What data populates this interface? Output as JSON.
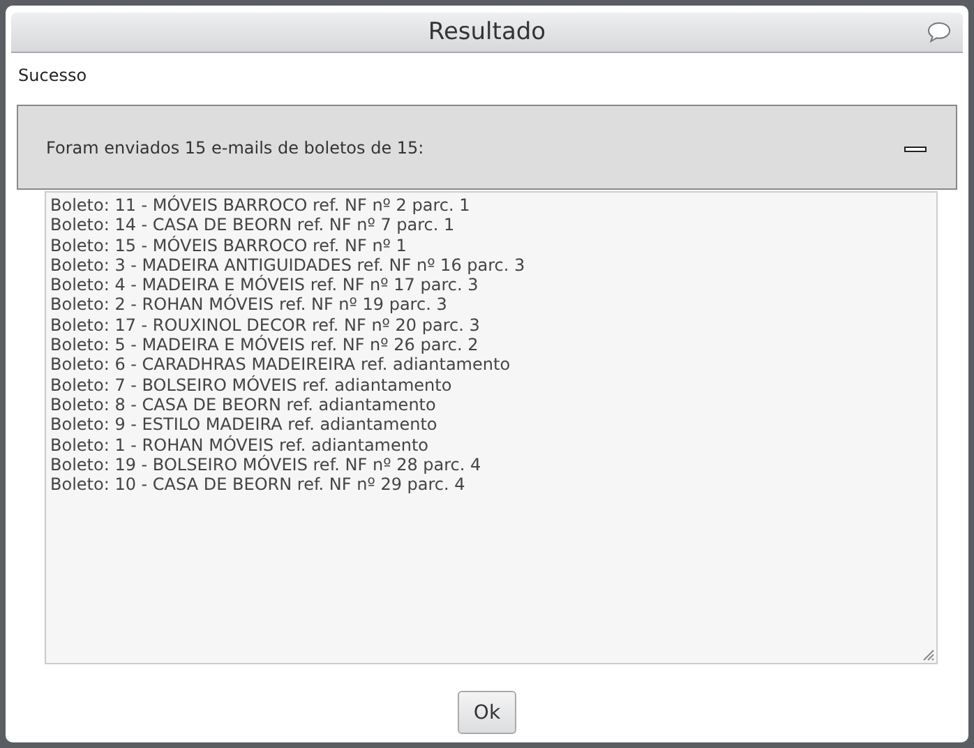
{
  "dialog": {
    "title": "Resultado",
    "status": "Sucesso"
  },
  "panel": {
    "message": "Foram enviados 15 e-mails de boletos de 15:"
  },
  "log_lines": [
    "Boleto: 11 - MÓVEIS BARROCO ref. NF nº 2 parc. 1",
    "Boleto: 14 - CASA DE BEORN ref. NF nº 7 parc. 1",
    "Boleto: 15 - MÓVEIS BARROCO ref. NF nº 1",
    "Boleto: 3 - MADEIRA ANTIGUIDADES ref. NF nº 16 parc. 3",
    "Boleto: 4 - MADEIRA E MÓVEIS ref. NF nº 17 parc. 3",
    "Boleto: 2 - ROHAN MÓVEIS ref. NF nº 19 parc. 3",
    "Boleto: 17 - ROUXINOL DECOR ref. NF nº 20 parc. 3",
    "Boleto: 5 - MADEIRA E MÓVEIS ref. NF nº 26 parc. 2",
    "Boleto: 6 - CARADHRAS MADEIREIRA ref. adiantamento",
    "Boleto: 7 - BOLSEIRO MÓVEIS ref. adiantamento",
    "Boleto: 8 - CASA DE BEORN ref. adiantamento",
    "Boleto: 9 - ESTILO MADEIRA ref. adiantamento",
    "Boleto: 1 - ROHAN MÓVEIS ref. adiantamento",
    "Boleto: 19 - BOLSEIRO MÓVEIS ref. NF nº 28 parc. 4",
    "Boleto: 10 - CASA DE BEORN ref. NF nº 29 parc. 4"
  ],
  "buttons": [
    "Ok"
  ]
}
